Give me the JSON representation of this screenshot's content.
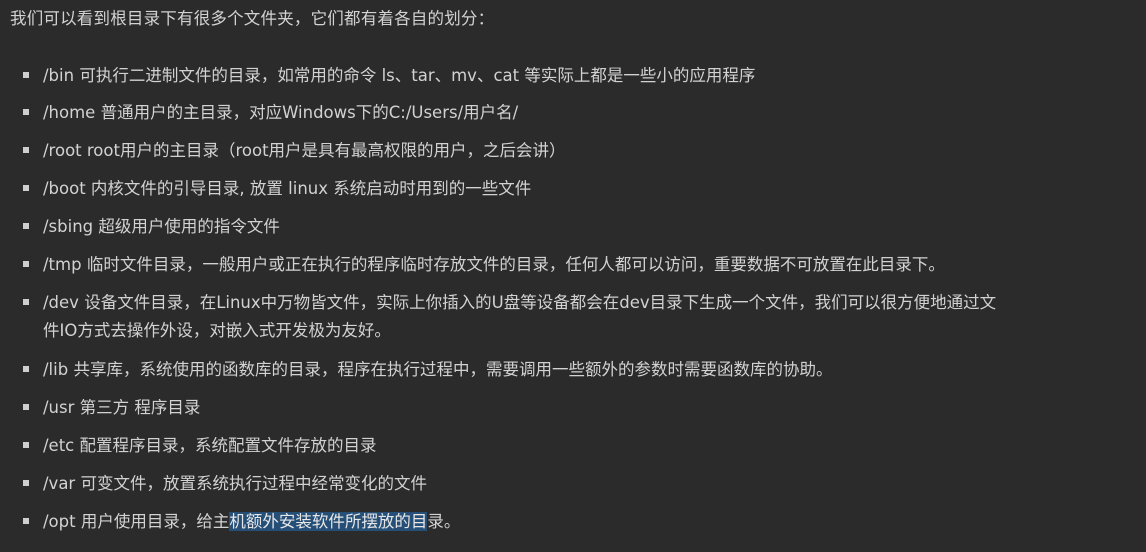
{
  "intro": "我们可以看到根目录下有很多个文件夹，它们都有着各自的划分：",
  "items": [
    {
      "text": "/bin 可执行二进制文件的目录，如常用的命令 ls、tar、mv、cat 等实际上都是一些小的应用程序"
    },
    {
      "text": "/home 普通用户的主目录，对应Windows下的C:/Users/用户名/"
    },
    {
      "text": "/root root用户的主目录（root用户是具有最高权限的用户，之后会讲）"
    },
    {
      "text": "/boot 内核文件的引导目录, 放置 linux 系统启动时用到的一些文件"
    },
    {
      "text": "/sbing 超级用户使用的指令文件"
    },
    {
      "text": "/tmp 临时文件目录，一般用户或正在执行的程序临时存放文件的目录，任何人都可以访问，重要数据不可放置在此目录下。"
    },
    {
      "line1": "/dev 设备文件目录，在Linux中万物皆文件，实际上你插入的U盘等设备都会在dev目录下生成一个文件，我们可以很方便地通过文",
      "line2": "件IO方式去操作外设，对嵌入式开发极为友好。"
    },
    {
      "text": "/lib 共享库，系统使用的函数库的目录，程序在执行过程中，需要调用一些额外的参数时需要函数库的协助。"
    },
    {
      "text": "/usr 第三方 程序目录"
    },
    {
      "text": "/etc 配置程序目录，系统配置文件存放的目录"
    },
    {
      "text": "/var 可变文件，放置系统执行过程中经常变化的文件"
    },
    {
      "pre": "/opt 用户使用目录，给主",
      "highlight": "机额外安装软件所摆放的目",
      "post": "录。"
    }
  ]
}
